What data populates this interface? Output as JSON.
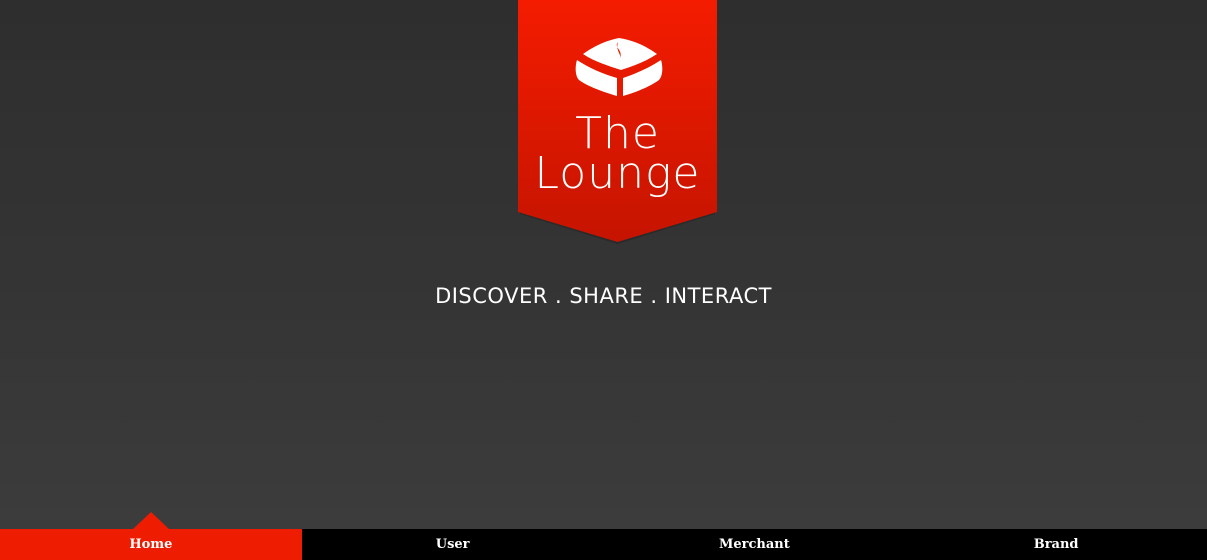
{
  "brand": {
    "name_line1": "The",
    "name_line2": "Lounge",
    "logo_icon": "box-logo-icon",
    "colors": {
      "accent": "#ee1c00",
      "accent_dark": "#c51400",
      "background": "#353535",
      "nav_background": "#000000",
      "text": "#ffffff"
    }
  },
  "hero": {
    "tagline": "DISCOVER . SHARE . INTERACT"
  },
  "nav": {
    "items": [
      {
        "label": "Home",
        "active": true
      },
      {
        "label": "User",
        "active": false
      },
      {
        "label": "Merchant",
        "active": false
      },
      {
        "label": "Brand",
        "active": false
      }
    ]
  }
}
